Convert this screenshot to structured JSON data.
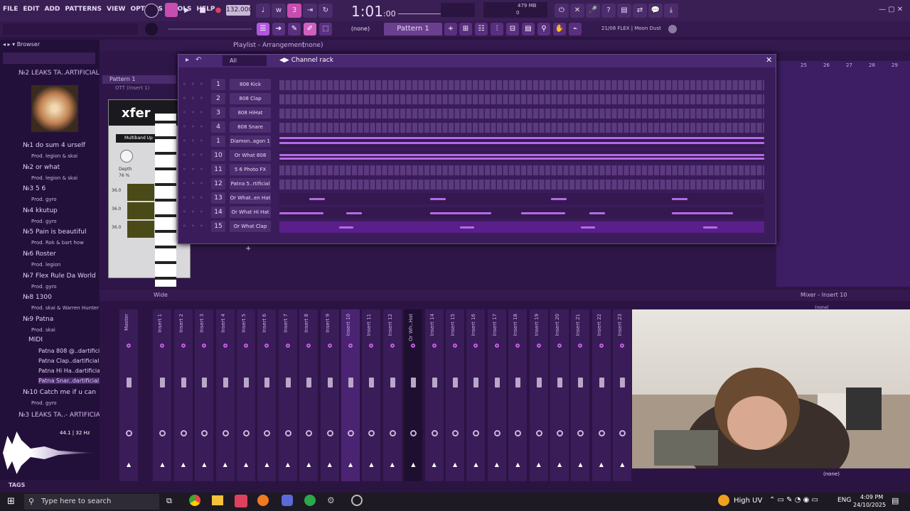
{
  "menu": [
    "FILE",
    "EDIT",
    "ADD",
    "PATTERNS",
    "VIEW",
    "OPTIONS",
    "TOOLS",
    "HELP"
  ],
  "toolbar": {
    "tempo": "132.000",
    "time": "1:01",
    "time_small": ":00",
    "mem": "479 MB",
    "mem_num": "5",
    "mem_zero": "0",
    "pattern": "Pattern 1",
    "snap": "(none)",
    "plugin_info": "21/08 FLEX | Moon Dust"
  },
  "browser": {
    "title": "Browser",
    "root": "№2 LEAKS TA..ARTIFICIAL",
    "items": [
      {
        "name": "№1 do sum 4 urself",
        "prod": "Prod. legion & skai"
      },
      {
        "name": "№2 or what",
        "prod": "Prod. legion & skai"
      },
      {
        "name": "№3 5 6",
        "prod": "Prod. gyro"
      },
      {
        "name": "№4 kkutup",
        "prod": "Prod. gyro"
      },
      {
        "name": "№5 Pain is beautiful",
        "prod": "Prod. Rok & bart how"
      },
      {
        "name": "№6 Roster",
        "prod": "Prod. legion"
      },
      {
        "name": "№7 Flex Rule Da World",
        "prod": "Prod. gyro"
      },
      {
        "name": "№8 1300",
        "prod": "Prod. skai & Warren Hunter"
      },
      {
        "name": "№9 Patna",
        "prod": "Prod. skai"
      }
    ],
    "midi": "MIDI",
    "midi_files": [
      "Patna 808 @..dartificial",
      "Patna Clap..dartificial",
      "Patna Hi Ha..dartificial",
      "Patna Snar..dartificial"
    ],
    "after": [
      {
        "name": "№10 Catch me if u can",
        "prod": "Prod. gyro"
      }
    ],
    "root2": "№3 LEAKS TA..- ARTIFICIAL",
    "wave_info": "44.1 | 32 Hz",
    "tags": "TAGS"
  },
  "playlist": {
    "title": "Playlist - Arrangement",
    "pattern_sel": "(none)",
    "track": "Pattern 1",
    "sub": "OTT (Insert 1)",
    "ruler": [
      "25",
      "26",
      "27",
      "28",
      "29"
    ]
  },
  "rack": {
    "title": "Channel rack",
    "filter": "All",
    "channels": [
      {
        "num": "1",
        "name": "808 Kick",
        "type": "steps"
      },
      {
        "num": "2",
        "name": "808 Clap",
        "type": "steps"
      },
      {
        "num": "3",
        "name": "808 HiHat",
        "type": "steps"
      },
      {
        "num": "4",
        "name": "808 Snare",
        "type": "steps"
      },
      {
        "num": "1",
        "name": "Diamon..agon 1",
        "type": "roll"
      },
      {
        "num": "10",
        "name": "Or What 808",
        "type": "roll"
      },
      {
        "num": "11",
        "name": "5 6 Photo FX",
        "type": "steps"
      },
      {
        "num": "12",
        "name": "Patna 5..rtificial",
        "type": "steps"
      },
      {
        "num": "13",
        "name": "Or What..en Hat",
        "type": "roll"
      },
      {
        "num": "14",
        "name": "Or What Hi Hat",
        "type": "roll"
      },
      {
        "num": "15",
        "name": "Or What Clap",
        "type": "roll"
      }
    ]
  },
  "vst": {
    "brand": "xfer",
    "preset": "Multiband Up",
    "depth": "Depth",
    "depth_val": "76 %",
    "db": [
      "36.0",
      "36.0",
      "36.0"
    ]
  },
  "mixer": {
    "title": "Mixer - Insert 10",
    "wide": "Wide",
    "strips": [
      "Master",
      "Insert 1",
      "Insert 2",
      "Insert 3",
      "Insert 4",
      "Insert 5",
      "Insert 6",
      "Insert 7",
      "Insert 8",
      "Insert 9",
      "Insert 10",
      "Insert 11",
      "Insert 12",
      "Or Wh..Hat",
      "Insert 14",
      "Insert 15",
      "Insert 16",
      "Insert 17",
      "Insert 18",
      "Insert 19",
      "Insert 20",
      "Insert 21",
      "Insert 22",
      "Insert 23"
    ],
    "route": "(none)",
    "slot": "(none)"
  },
  "taskbar": {
    "search": "Type here to search",
    "weather": "High UV",
    "lang": "ENG",
    "time": "4:09 PM",
    "date": "24/10/2025"
  },
  "colors": {
    "accent": "#b36be6",
    "bg": "#2a1540"
  }
}
